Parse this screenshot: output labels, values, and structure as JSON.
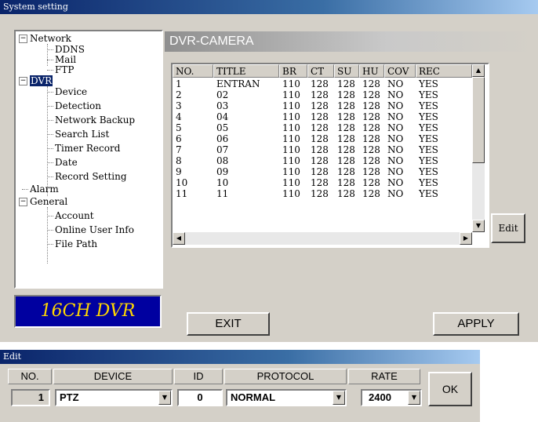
{
  "main_window": {
    "title": "System setting"
  },
  "tree": {
    "network": "Network",
    "ddns": "DDNS",
    "mail": "Mail",
    "ftp": "FTP",
    "dvr": "DVR",
    "device": "Device",
    "detection": "Detection",
    "network_backup": "Network Backup",
    "search_list": "Search List",
    "timer_record": "Timer Record",
    "date": "Date",
    "record_setting": "Record Setting",
    "alarm": "Alarm",
    "general": "General",
    "account": "Account",
    "online_user_info": "Online User Info",
    "file_path": "File Path"
  },
  "logo_text": "16CH DVR",
  "camera_panel": {
    "title": "DVR-CAMERA",
    "columns": [
      "NO.",
      "TITLE",
      "BR",
      "CT",
      "SU",
      "HU",
      "COV",
      "REC"
    ],
    "rows": [
      [
        "1",
        "ENTRAN",
        "110",
        "128",
        "128",
        "128",
        "NO",
        "YES"
      ],
      [
        "2",
        "02",
        "110",
        "128",
        "128",
        "128",
        "NO",
        "YES"
      ],
      [
        "3",
        "03",
        "110",
        "128",
        "128",
        "128",
        "NO",
        "YES"
      ],
      [
        "4",
        "04",
        "110",
        "128",
        "128",
        "128",
        "NO",
        "YES"
      ],
      [
        "5",
        "05",
        "110",
        "128",
        "128",
        "128",
        "NO",
        "YES"
      ],
      [
        "6",
        "06",
        "110",
        "128",
        "128",
        "128",
        "NO",
        "YES"
      ],
      [
        "7",
        "07",
        "110",
        "128",
        "128",
        "128",
        "NO",
        "YES"
      ],
      [
        "8",
        "08",
        "110",
        "128",
        "128",
        "128",
        "NO",
        "YES"
      ],
      [
        "9",
        "09",
        "110",
        "128",
        "128",
        "128",
        "NO",
        "YES"
      ],
      [
        "10",
        "10",
        "110",
        "128",
        "128",
        "128",
        "NO",
        "YES"
      ],
      [
        "11",
        "11",
        "110",
        "128",
        "128",
        "128",
        "NO",
        "YES"
      ]
    ],
    "edit_label": "Edit"
  },
  "buttons": {
    "exit": "EXIT",
    "apply": "APPLY"
  },
  "edit_window": {
    "title": "Edit",
    "headers": {
      "no": "NO.",
      "device": "DEVICE",
      "id": "ID",
      "protocol": "PROTOCOL",
      "rate": "RATE"
    },
    "values": {
      "no": "1",
      "device": "PTZ",
      "id": "0",
      "protocol": "NORMAL",
      "rate": "2400"
    },
    "ok_label": "OK"
  }
}
